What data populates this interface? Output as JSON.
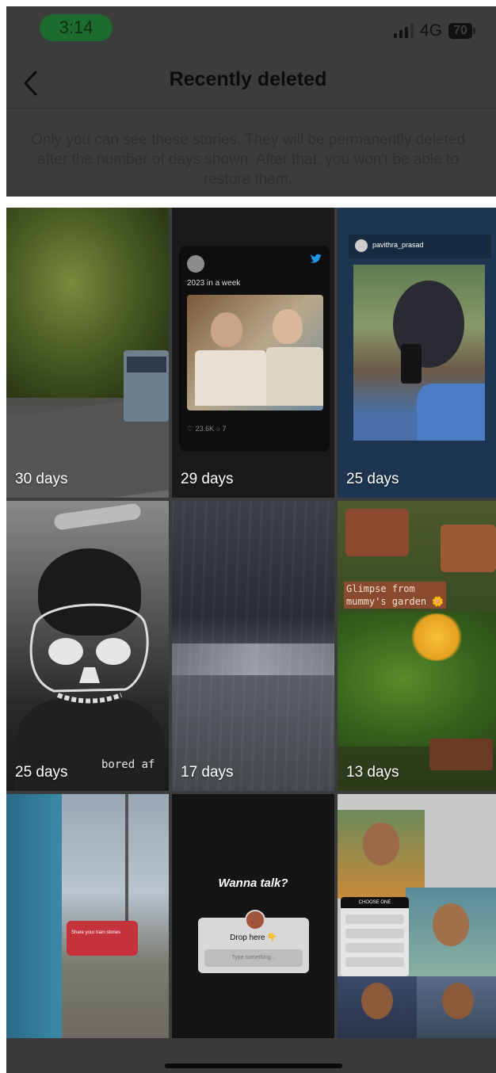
{
  "status": {
    "time": "3:14",
    "network": "4G",
    "battery": "70"
  },
  "header": {
    "title": "Recently deleted"
  },
  "description": "Only you can see these stories. They will be permanently deleted after the number of days shown. After that, you won't be able to restore them.",
  "stories": [
    {
      "days": "30 days"
    },
    {
      "days": "29 days",
      "tweet_text": "2023 in a week",
      "tweet_stats": "♡ 23.6K  ○ 7"
    },
    {
      "days": "25 days",
      "username": "pavithra_prasad"
    },
    {
      "days": "25 days",
      "caption": "bored af"
    },
    {
      "days": "17 days"
    },
    {
      "days": "13 days",
      "caption_line1": "Glimpse from",
      "caption_line2": "mummy's garden 🌼"
    },
    {
      "days": "",
      "sticker": "Share your train stories"
    },
    {
      "days": "",
      "heading": "Wanna talk?",
      "drop_label": "Drop here 👇",
      "input_placeholder": "Type something..."
    },
    {
      "days": "",
      "poll_title": "CHOOSE ONE"
    }
  ],
  "colors": {
    "overlay": "#3c3c3c",
    "time_pill": "#1e6b30"
  }
}
